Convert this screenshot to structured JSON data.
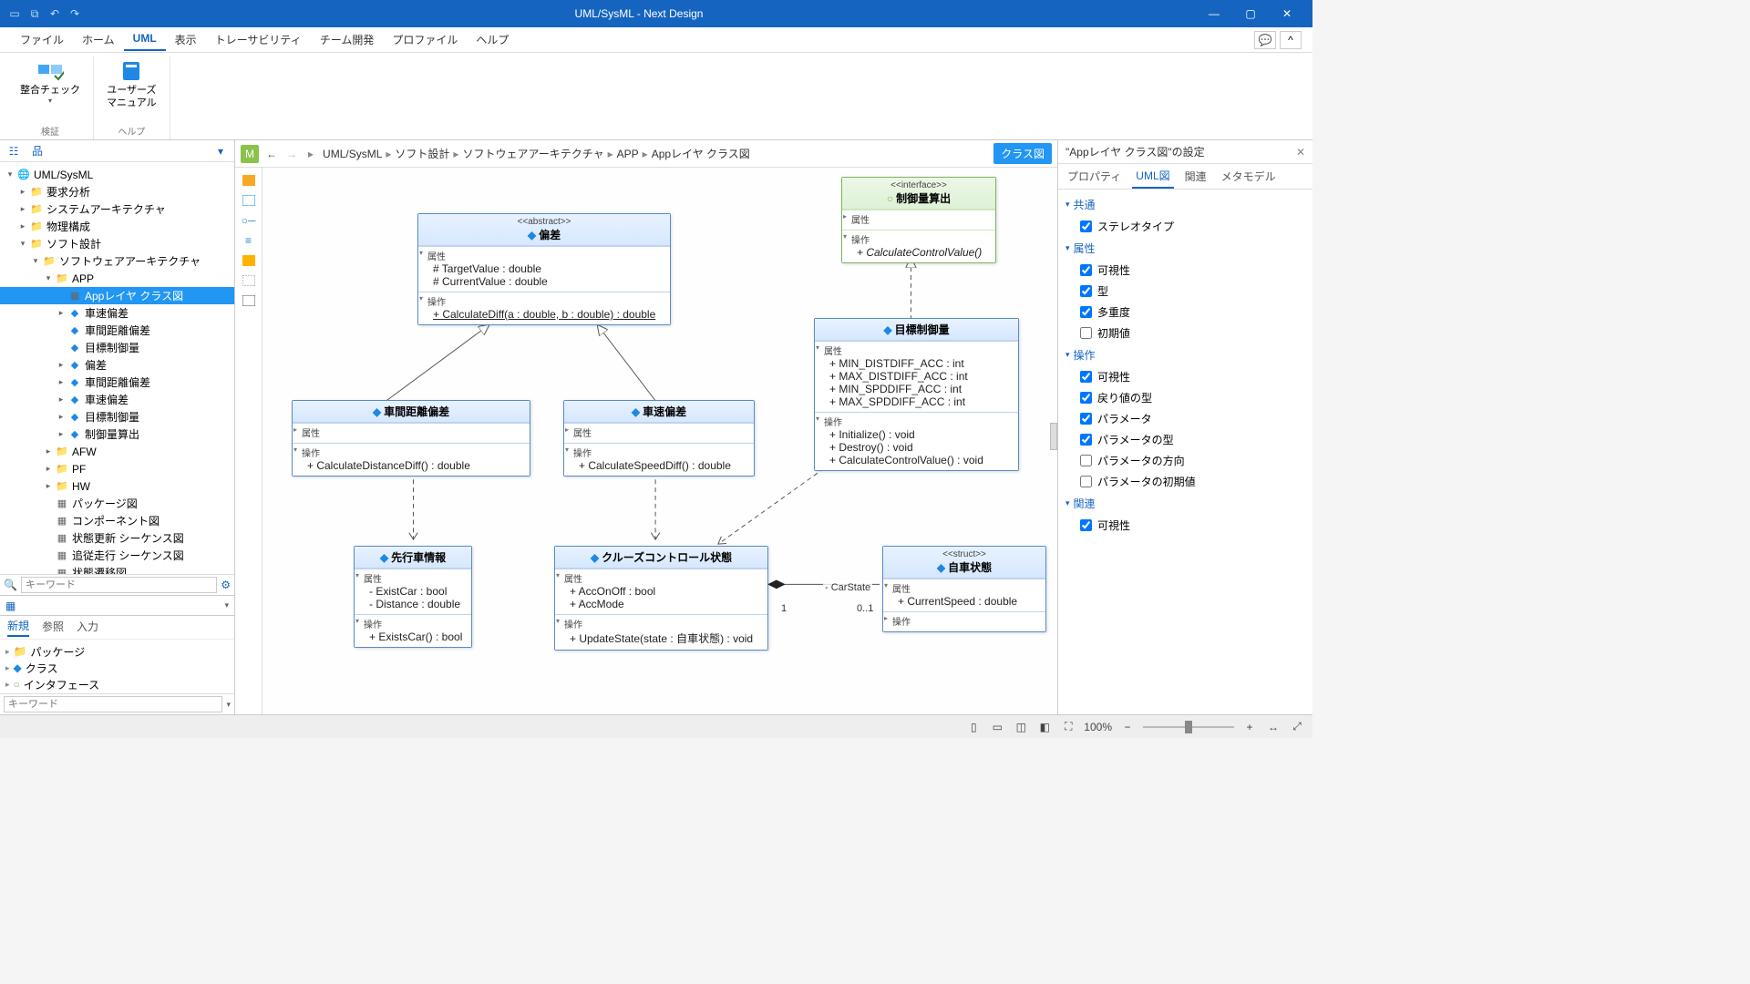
{
  "app_title": "UML/SysML - Next Design",
  "menubar": [
    "ファイル",
    "ホーム",
    "UML",
    "表示",
    "トレーサビリティ",
    "チーム開発",
    "プロファイル",
    "ヘルプ"
  ],
  "menubar_active_index": 2,
  "ribbon": {
    "group1_label": "検証",
    "btn1_label": "整合チェック",
    "group2_label": "ヘルプ",
    "btn2_label": "ユーザーズ\nマニュアル"
  },
  "tree": [
    {
      "depth": 0,
      "expand": "▾",
      "icon": "globe",
      "label": "UML/SysML"
    },
    {
      "depth": 1,
      "expand": "▸",
      "icon": "folder",
      "label": "要求分析"
    },
    {
      "depth": 1,
      "expand": "▸",
      "icon": "folder",
      "label": "システムアーキテクチャ"
    },
    {
      "depth": 1,
      "expand": "▸",
      "icon": "folder",
      "label": "物理構成"
    },
    {
      "depth": 1,
      "expand": "▾",
      "icon": "folder",
      "label": "ソフト設計"
    },
    {
      "depth": 2,
      "expand": "▾",
      "icon": "folder",
      "label": "ソフトウェアアーキテクチャ"
    },
    {
      "depth": 3,
      "expand": "▾",
      "icon": "folder",
      "label": "APP"
    },
    {
      "depth": 4,
      "expand": " ",
      "icon": "diag",
      "label": "Appレイヤ クラス図",
      "selected": true
    },
    {
      "depth": 4,
      "expand": "▸",
      "icon": "class",
      "label": "車速偏差"
    },
    {
      "depth": 4,
      "expand": " ",
      "icon": "class",
      "label": "車間距離偏差"
    },
    {
      "depth": 4,
      "expand": " ",
      "icon": "class",
      "label": "目標制御量"
    },
    {
      "depth": 4,
      "expand": "▸",
      "icon": "class",
      "label": "偏差"
    },
    {
      "depth": 4,
      "expand": "▸",
      "icon": "class",
      "label": "車間距離偏差"
    },
    {
      "depth": 4,
      "expand": "▸",
      "icon": "class",
      "label": "車速偏差"
    },
    {
      "depth": 4,
      "expand": "▸",
      "icon": "class",
      "label": "目標制御量"
    },
    {
      "depth": 4,
      "expand": "▸",
      "icon": "class",
      "label": "制御量算出"
    },
    {
      "depth": 3,
      "expand": "▸",
      "icon": "folder",
      "label": "AFW"
    },
    {
      "depth": 3,
      "expand": "▸",
      "icon": "folder",
      "label": "PF"
    },
    {
      "depth": 3,
      "expand": "▸",
      "icon": "folder",
      "label": "HW"
    },
    {
      "depth": 3,
      "expand": " ",
      "icon": "diag",
      "label": "パッケージ図"
    },
    {
      "depth": 3,
      "expand": " ",
      "icon": "diag",
      "label": "コンポーネント図"
    },
    {
      "depth": 3,
      "expand": " ",
      "icon": "diag",
      "label": "状態更新 シーケンス図"
    },
    {
      "depth": 3,
      "expand": " ",
      "icon": "diag",
      "label": "追従走行 シーケンス図"
    },
    {
      "depth": 3,
      "expand": " ",
      "icon": "diag",
      "label": "状態遷移図"
    }
  ],
  "filter_placeholder": "キーワード",
  "bottom_tabs": [
    "新規",
    "参照",
    "入力"
  ],
  "bottom_tabs_active": 0,
  "bottom_items": [
    "パッケージ",
    "クラス",
    "インタフェース"
  ],
  "bottom_filter_placeholder": "キーワード",
  "breadcrumb": [
    "UML/SysML",
    "ソフト設計",
    "ソフトウェアアーキテクチャ",
    "APP",
    "Appレイヤ クラス図"
  ],
  "class_chip": "クラス図",
  "rp_title": "\"Appレイヤ クラス図\"の設定",
  "rp_tabs": [
    "プロパティ",
    "UML図",
    "関連",
    "メタモデル"
  ],
  "rp_tabs_active": 1,
  "rp_sections": [
    {
      "title": "共通",
      "checks": [
        {
          "label": "ステレオタイプ",
          "checked": true
        }
      ]
    },
    {
      "title": "属性",
      "checks": [
        {
          "label": "可視性",
          "checked": true
        },
        {
          "label": "型",
          "checked": true
        },
        {
          "label": "多重度",
          "checked": true
        },
        {
          "label": "初期値",
          "checked": false
        }
      ]
    },
    {
      "title": "操作",
      "checks": [
        {
          "label": "可視性",
          "checked": true
        },
        {
          "label": "戻り値の型",
          "checked": true
        },
        {
          "label": "パラメータ",
          "checked": true
        },
        {
          "label": "パラメータの型",
          "checked": true
        },
        {
          "label": "パラメータの方向",
          "checked": false
        },
        {
          "label": "パラメータの初期値",
          "checked": false
        }
      ]
    },
    {
      "title": "関連",
      "checks": [
        {
          "label": "可視性",
          "checked": true
        }
      ]
    }
  ],
  "status": {
    "zoom": "100%"
  },
  "uml": {
    "abstract": {
      "stereotype": "<<abstract>>",
      "name": "偏差",
      "attrs_label": "属性",
      "ops_label": "操作",
      "attrs": [
        "# TargetValue : double",
        "# CurrentValue : double"
      ],
      "ops": [
        "+ CalculateDiff(a : double, b : double) : double"
      ]
    },
    "interface": {
      "stereotype": "<<interface>>",
      "name": "制御量算出",
      "attrs_label": "属性",
      "ops_label": "操作",
      "ops": [
        "+ CalculateControlValue()"
      ]
    },
    "dist": {
      "name": "車間距離偏差",
      "attrs_label": "属性",
      "ops_label": "操作",
      "ops": [
        "+ CalculateDistanceDiff() : double"
      ]
    },
    "speed": {
      "name": "車速偏差",
      "attrs_label": "属性",
      "ops_label": "操作",
      "ops": [
        "+ CalculateSpeedDiff() : double"
      ]
    },
    "target": {
      "name": "目標制御量",
      "attrs_label": "属性",
      "ops_label": "操作",
      "attrs": [
        "+ MIN_DISTDIFF_ACC : int",
        "+ MAX_DISTDIFF_ACC : int",
        "+ MIN_SPDDIFF_ACC : int",
        "+ MAX_SPDDIFF_ACC : int"
      ],
      "ops": [
        "+ Initialize() : void",
        "+ Destroy() : void",
        "+ CalculateControlValue() : void"
      ]
    },
    "leading": {
      "name": "先行車情報",
      "attrs_label": "属性",
      "ops_label": "操作",
      "attrs": [
        "- ExistCar : bool",
        "- Distance : double"
      ],
      "ops": [
        "+ ExistsCar() : bool"
      ]
    },
    "cruise": {
      "name": "クルーズコントロール状態",
      "attrs_label": "属性",
      "ops_label": "操作",
      "attrs": [
        "+ AccOnOff : bool",
        "+ AccMode"
      ],
      "ops": [
        "+ UpdateState(state : 自車状態) : void"
      ]
    },
    "car": {
      "stereotype": "<<struct>>",
      "name": "自車状態",
      "attrs_label": "属性",
      "ops_label": "操作",
      "attrs": [
        "+ CurrentSpeed : double"
      ]
    },
    "assoc": {
      "role": "- CarState",
      "mult_left": "1",
      "mult_right": "0..1"
    }
  }
}
